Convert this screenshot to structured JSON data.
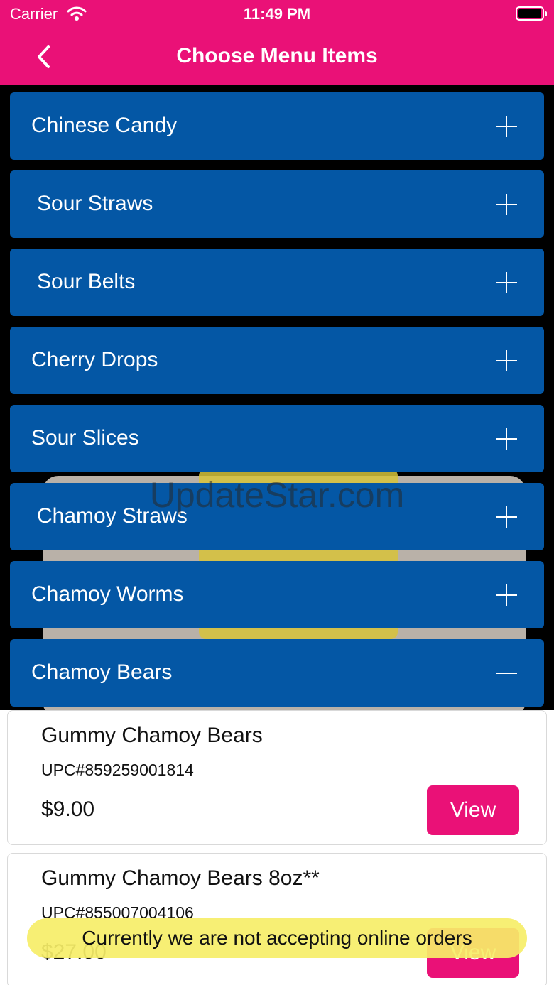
{
  "status_bar": {
    "carrier": "Carrier",
    "time": "11:49 PM"
  },
  "nav": {
    "title": "Choose Menu Items"
  },
  "watermark": "UpdateStar.com",
  "categories": [
    {
      "label": "Chinese Candy",
      "state": "collapsed"
    },
    {
      "label": "Sour Straws",
      "state": "collapsed"
    },
    {
      "label": "Sour Belts",
      "state": "collapsed"
    },
    {
      "label": "Cherry Drops",
      "state": "collapsed"
    },
    {
      "label": "Sour Slices",
      "state": "collapsed"
    },
    {
      "label": "Chamoy Straws",
      "state": "collapsed"
    },
    {
      "label": "Chamoy Worms",
      "state": "collapsed"
    },
    {
      "label": "Chamoy Bears",
      "state": "expanded"
    }
  ],
  "products": [
    {
      "name": "Gummy Chamoy Bears",
      "upc": "UPC#859259001814",
      "price": "$9.00",
      "button": "View"
    },
    {
      "name": "Gummy Chamoy Bears 8oz**",
      "upc": "UPC#855007004106",
      "price": "$27.00",
      "button": "View"
    }
  ],
  "toast": "Currently we are not accepting online orders",
  "colors": {
    "brand_pink": "#ea1177",
    "category_blue": "#0457a5",
    "toast_yellow": "#f6ee68"
  }
}
